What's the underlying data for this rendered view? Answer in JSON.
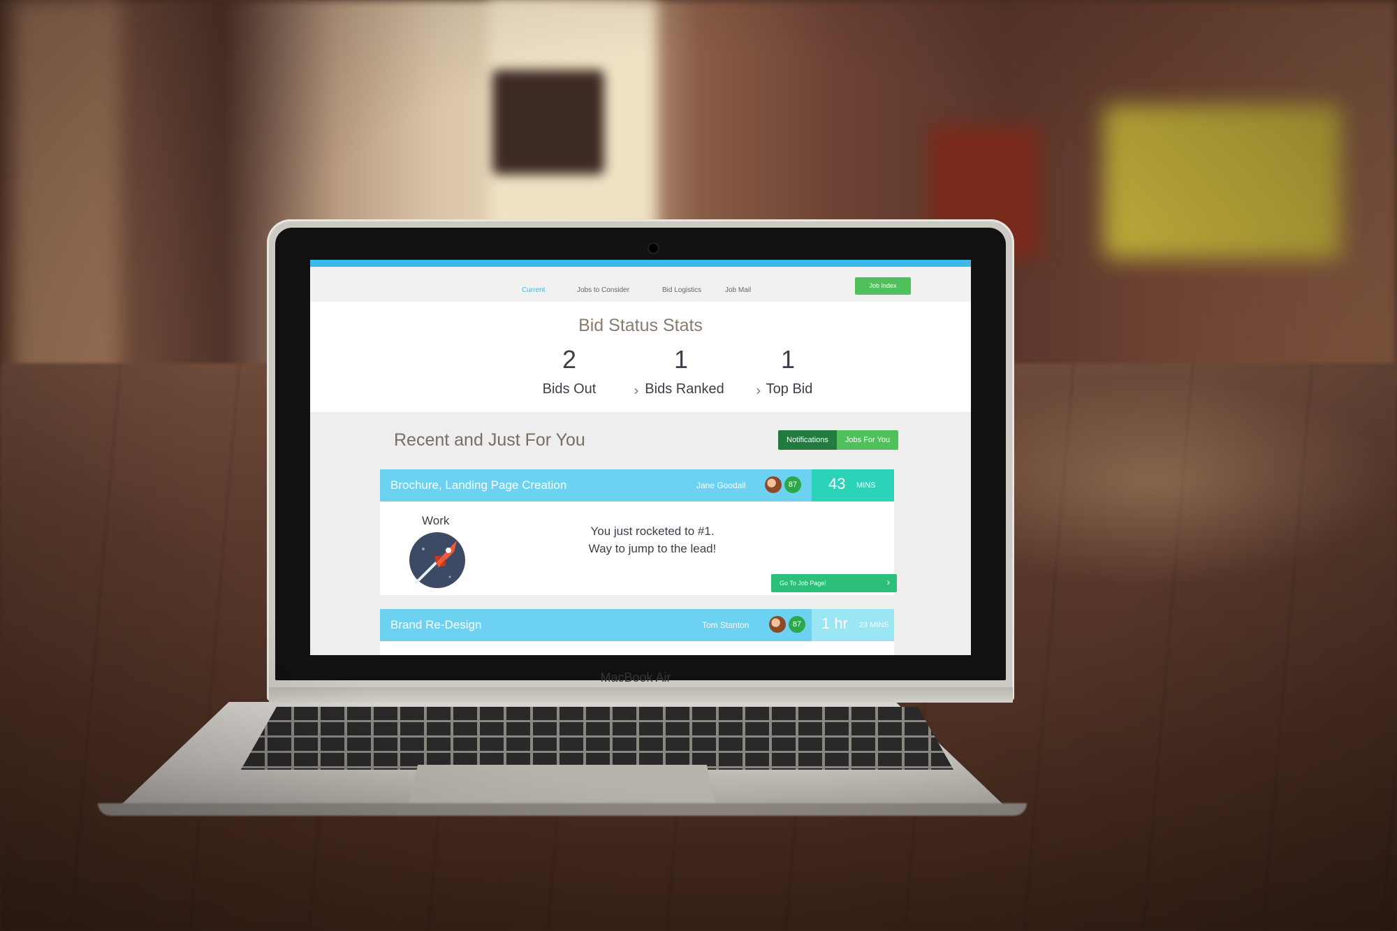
{
  "device": {
    "brand_label": "MacBook Air"
  },
  "nav": {
    "items": [
      {
        "label": "Current",
        "active": true
      },
      {
        "label": "Jobs to Consider",
        "active": false
      },
      {
        "label": "Bid Logistics",
        "active": false
      },
      {
        "label": "Job Mail",
        "active": false
      }
    ],
    "job_index_label": "Job Index"
  },
  "stats": {
    "title": "Bid Status Stats",
    "items": [
      {
        "value": "2",
        "label": "Bids Out"
      },
      {
        "value": "1",
        "label": "Bids Ranked"
      },
      {
        "value": "1",
        "label": "Top Bid"
      }
    ]
  },
  "recent": {
    "title": "Recent and Just For You",
    "toggle": {
      "notifications_label": "Notifications",
      "jobs_label": "Jobs For You"
    },
    "cards": [
      {
        "title": "Brochure, Landing Page Creation",
        "user": "Jane Goodall",
        "score": "87",
        "time_value": "43",
        "time_unit": "MINS",
        "work_label": "Work",
        "message_line1": "You just rocketed to #1.",
        "message_line2": "Way to jump to the lead!",
        "button_label": "Go To Job Page!"
      },
      {
        "title": "Brand Re-Design",
        "user": "Tom Stanton",
        "score": "87",
        "time_value": "1 hr",
        "time_unit": "23 MINS"
      }
    ]
  },
  "colors": {
    "accent_blue": "#3cb9eb",
    "card_header": "#6dd2f2",
    "green": "#4fc05a",
    "dark_green": "#227a3e",
    "teal": "#2cd3b8"
  },
  "icons": [
    "rocket-icon",
    "chevron-right-icon",
    "avatar"
  ]
}
